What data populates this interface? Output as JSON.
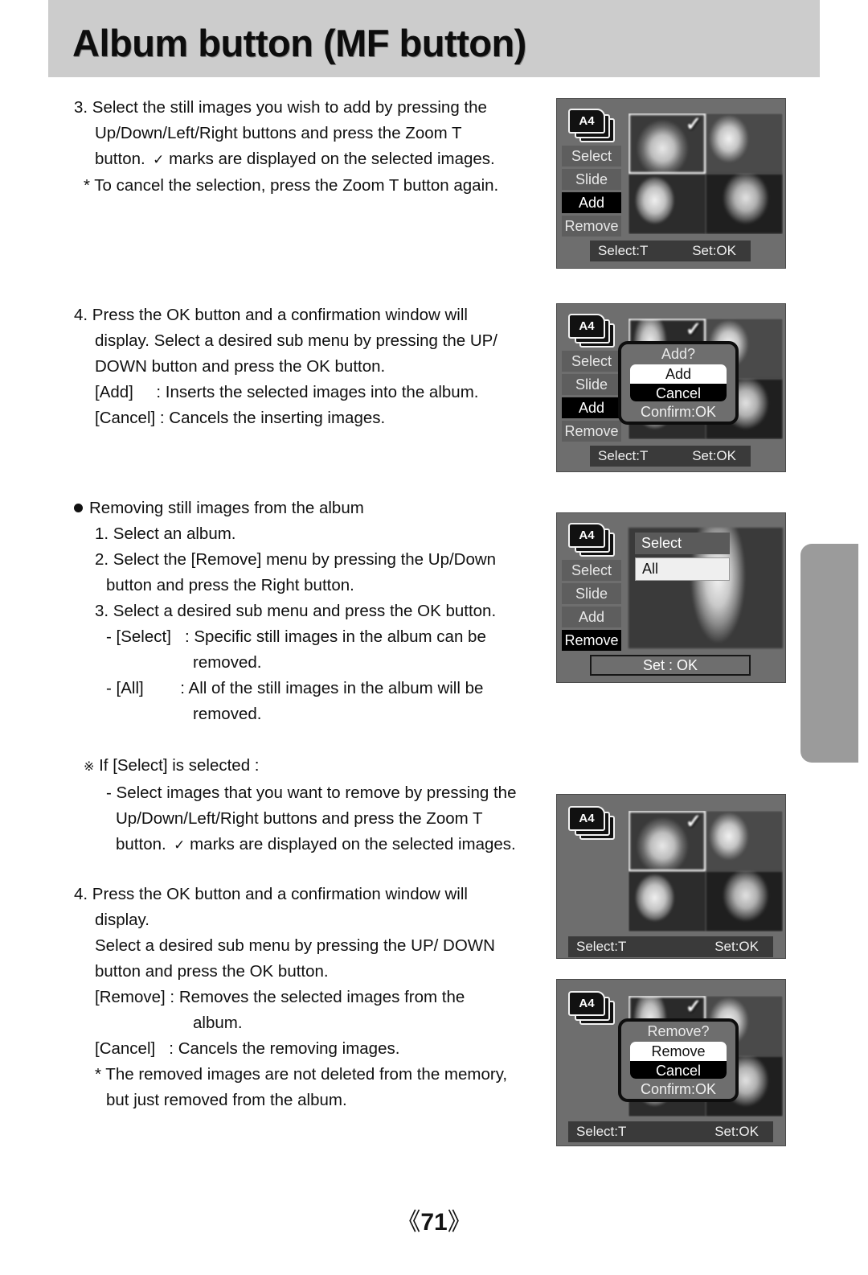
{
  "header": {
    "title": "Album button (MF button)"
  },
  "page_number": {
    "open": "《",
    "value": "71",
    "close": "》"
  },
  "body": {
    "step3": {
      "lines": [
        "3. Select the still images you wish to add by pressing the",
        "Up/Down/Left/Right buttons and press the Zoom T",
        "button."
      ],
      "check_tail": " marks are displayed on the selected images.",
      "note": "* To cancel the selection, press the Zoom T button again."
    },
    "step4_add": {
      "lines": [
        "4. Press the OK button and a confirmation window will",
        "display. Select a desired sub menu by pressing the UP/",
        "DOWN button and press the OK button."
      ],
      "defs": [
        {
          "label": "[Add]     ",
          "text": ": Inserts the selected images into the album."
        },
        {
          "label": "[Cancel] ",
          "text": ": Cancels the inserting images."
        }
      ]
    },
    "removing": {
      "heading": "Removing still images from the album",
      "steps": [
        "1. Select an album.",
        "2. Select the [Remove] menu by pressing the Up/Down",
        "button and press the Right button.",
        "3. Select a desired sub menu and press the OK button."
      ],
      "defs": [
        {
          "label": "- [Select]   ",
          "text": ": Specific still images in the album can be",
          "cont": "removed."
        },
        {
          "label": "- [All]        ",
          "text": ": All of the still images in the album will be",
          "cont": "removed."
        }
      ]
    },
    "if_select": {
      "heading_mark": "※",
      "heading": " If [Select] is selected :",
      "lines": [
        "- Select images that you want to remove by pressing the",
        "Up/Down/Left/Right buttons and press the Zoom T",
        "button."
      ],
      "check_tail": " marks are displayed on the selected images."
    },
    "step4_remove": {
      "lines": [
        "4. Press the OK button and a confirmation window will",
        "display.",
        "Select a desired sub menu by pressing the UP/ DOWN",
        "button and press the OK button."
      ],
      "defs": [
        {
          "label": "[Remove] ",
          "text": ": Removes the selected images from the",
          "cont": "album."
        },
        {
          "label": "[Cancel]   ",
          "text": ": Cancels the removing images."
        }
      ],
      "notes": [
        "* The removed images are not deleted from the memory,",
        "but just removed from the album."
      ]
    }
  },
  "lcd_panels": [
    {
      "id": "panel-add-select",
      "album_label": "A4",
      "menu": [
        {
          "label": "Select",
          "selected": false
        },
        {
          "label": "Slide",
          "selected": false
        },
        {
          "label": "Add",
          "selected": true
        },
        {
          "label": "Remove",
          "selected": false
        }
      ],
      "grid_check": "✓",
      "status_left": "Select:T",
      "status_right": "Set:OK"
    },
    {
      "id": "panel-add-confirm",
      "album_label": "A4",
      "menu": [
        {
          "label": "Select",
          "selected": false
        },
        {
          "label": "Slide",
          "selected": false
        },
        {
          "label": "Add",
          "selected": true
        },
        {
          "label": "Remove",
          "selected": false
        }
      ],
      "grid_check": "✓",
      "dialog": {
        "title": "Add?",
        "options": [
          {
            "label": "Add",
            "selected": false
          },
          {
            "label": "Cancel",
            "selected": true
          }
        ],
        "footer": "Confirm:OK"
      },
      "status_left": "Select:T",
      "status_right": "Set:OK"
    },
    {
      "id": "panel-remove-submenu",
      "album_label": "A4",
      "menu": [
        {
          "label": "Select",
          "selected": false
        },
        {
          "label": "Slide",
          "selected": false
        },
        {
          "label": "Add",
          "selected": false
        },
        {
          "label": "Remove",
          "selected": true
        }
      ],
      "submenu": [
        {
          "label": "Select",
          "highlighted": false
        },
        {
          "label": "All",
          "highlighted": true
        }
      ],
      "setbar": "Set : OK"
    },
    {
      "id": "panel-remove-select",
      "album_label": "A4",
      "grid_check": "✓",
      "status_left": "Select:T",
      "status_right": "Set:OK"
    },
    {
      "id": "panel-remove-confirm",
      "album_label": "A4",
      "grid_check": "✓",
      "dialog": {
        "title": "Remove?",
        "options": [
          {
            "label": "Remove",
            "selected": false
          },
          {
            "label": "Cancel",
            "selected": true
          }
        ],
        "footer": "Confirm:OK"
      },
      "status_left": "Select:T",
      "status_right": "Set:OK"
    }
  ],
  "colors": {
    "header_band": "#cccccc",
    "lcd_bg": "#6e6e6e",
    "menu_item_bg": "#5e5e5e",
    "menu_item_selected_bg": "#000000",
    "status_bar_bg": "#3a3a3a",
    "thumb_tab": "#9b9b9b"
  }
}
